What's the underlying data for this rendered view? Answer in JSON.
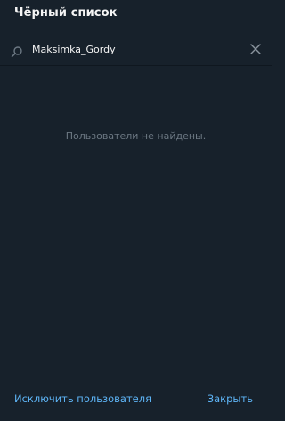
{
  "dialog": {
    "title": "Чёрный список"
  },
  "search": {
    "value": "Maksimka_Gordy",
    "icon": "search-icon",
    "clear_icon": "close-icon"
  },
  "results": {
    "empty_message": "Пользователи не найдены."
  },
  "footer": {
    "exclude_label": "Исключить пользователя",
    "close_label": "Закрыть"
  },
  "colors": {
    "background": "#17212b",
    "accent": "#5eb5f7",
    "muted_text": "#6c7883"
  }
}
